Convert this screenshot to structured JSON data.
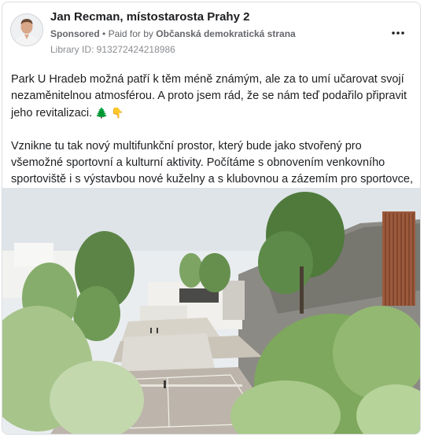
{
  "post": {
    "author": "Jan Recman, místostarosta Prahy 2",
    "sponsored_label": "Sponsored",
    "separator": "•",
    "paid_for_by_prefix": "Paid for by",
    "payer": "Občanská demokratická strana",
    "library_id": "Library ID: 913272424218986",
    "more_icon": "more-options-icon",
    "paragraph_1": "Park U Hradeb možná patří k těm méně známým, ale za to umí učarovat svojí nezaměnitelnou atmosférou. A proto jsem rád, že se nám teď podařilo připravit jeho revitalizaci.",
    "emoji_tree": "🌲",
    "emoji_point": "👇",
    "paragraph_2": "Vznikne tu tak nový multifunkční prostor, který bude jako stvořený pro všemožné sportovní a kulturní aktivity. Počítáme s obnovením venkovního sportoviště i s výstavbou nové kuželny a s klubovnou a zázemím pro sportovce, protože park m…"
  },
  "image": {
    "description_icon": "park-visualization-image",
    "sky_color": "#e8ecef",
    "tree_color": "#6a8f4e",
    "court_color": "#b9b1a8"
  }
}
